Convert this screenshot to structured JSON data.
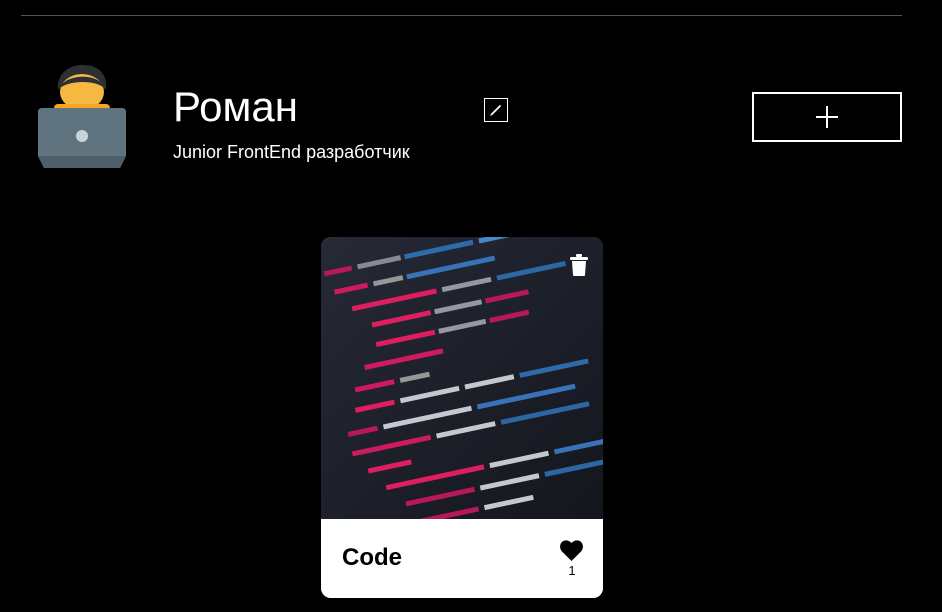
{
  "profile": {
    "name": "Роман",
    "about": "Junior FrontEnd разработчик",
    "avatar_icon": "developer-laptop-icon"
  },
  "toolbar": {
    "edit_icon": "pencil-icon",
    "add_icon": "plus-icon"
  },
  "cards": [
    {
      "title": "Code",
      "likes": "1",
      "image_icon": "code-screen-photo",
      "delete_icon": "trash-icon",
      "like_icon": "heart-icon"
    }
  ],
  "colors": {
    "background": "#000000",
    "text": "#ffffff",
    "card_footer": "#ffffff",
    "divider": "#545454"
  }
}
